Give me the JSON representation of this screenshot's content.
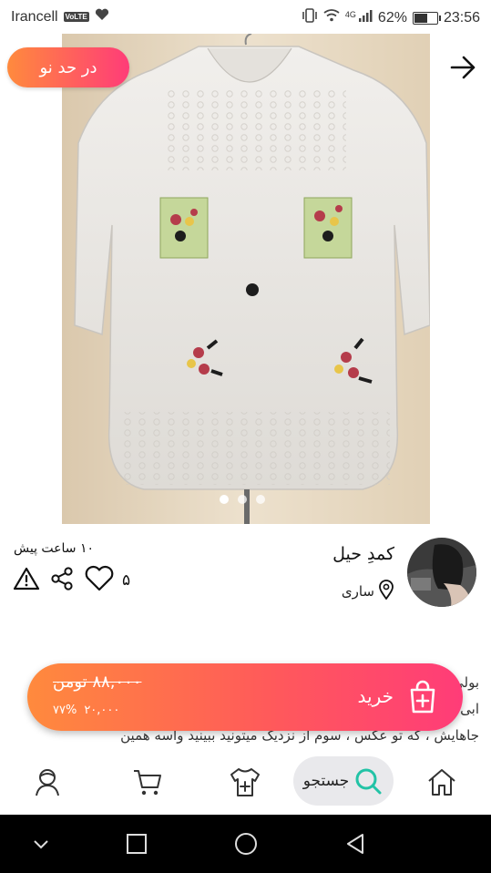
{
  "status_bar": {
    "carrier": "Irancell",
    "volte": "VoLTE",
    "network": "4G",
    "battery": "62%",
    "battery_level": 0.62,
    "time": "23:56"
  },
  "listing": {
    "badge": "در حد نو",
    "image_count": 3,
    "active_image": 0,
    "time_ago": "۱۰ ساعت پیش",
    "like_count": "۵"
  },
  "seller": {
    "name": "کمدِ حیل",
    "city": "ساری"
  },
  "description": {
    "lines": [
      "بولی",
      "ابی",
      "جاهایش ، که تو عکس ، سوم از نزدیک میتونید ببینید واسه همین"
    ]
  },
  "purchase": {
    "old_price": "۸۸,۰۰۰ تومن",
    "discount_percent": "۷۷%",
    "new_price": "۲۰,۰۰۰",
    "buy_label": "خرید"
  },
  "bottom_nav": {
    "search_label": "جستجو"
  },
  "colors": {
    "gradient_start": "#ff8a3d",
    "gradient_end": "#ff3c78",
    "search_icon": "#22c3a6"
  }
}
